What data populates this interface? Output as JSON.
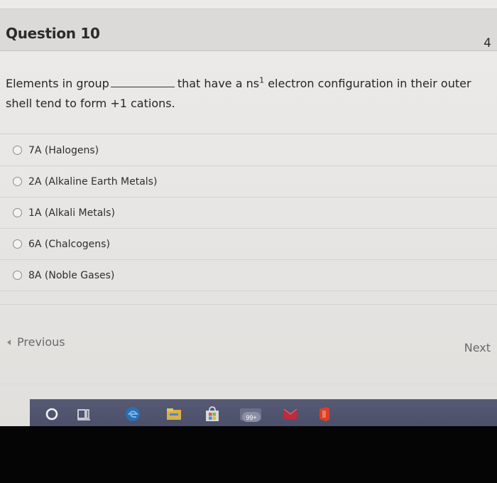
{
  "question": {
    "title": "Question 10",
    "points": "4",
    "text_before": "Elements in group",
    "text_middle": "that have a ns",
    "superscript": "1",
    "text_after": " electron configuration in their outer shell tend to form +1 cations."
  },
  "options": [
    {
      "label": "7A (Halogens)"
    },
    {
      "label": "2A (Alkaline Earth Metals)"
    },
    {
      "label": "1A (Alkali Metals)"
    },
    {
      "label": "6A (Chalcogens)"
    },
    {
      "label": "8A (Noble Gases)"
    }
  ],
  "navigation": {
    "previous_label": "Previous",
    "next_label": "Next"
  },
  "taskbar": {
    "mail_badge": "99+",
    "icons": [
      "cortana-circle-icon",
      "task-view-icon",
      "edge-browser-icon",
      "file-explorer-icon",
      "store-icon",
      "mail-icon",
      "office-icon",
      "office-app-icon"
    ],
    "accent_color": "#4a4e68"
  }
}
